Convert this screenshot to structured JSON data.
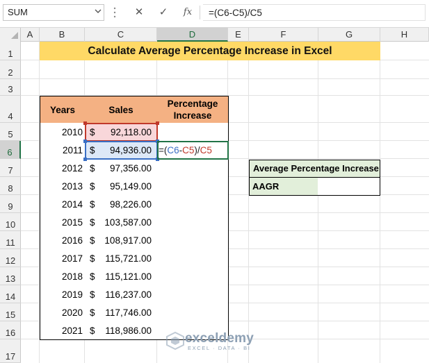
{
  "formula_bar": {
    "name_box": "SUM",
    "cancel_glyph": "✕",
    "enter_glyph": "✓",
    "fx_label": "fx",
    "formula": "=(C6-C5)/C5"
  },
  "columns": [
    "A",
    "B",
    "C",
    "D",
    "E",
    "F",
    "G",
    "H"
  ],
  "rows": [
    "1",
    "2",
    "3",
    "4",
    "5",
    "6",
    "7",
    "8",
    "9",
    "10",
    "11",
    "12",
    "13",
    "14",
    "15",
    "16",
    "17"
  ],
  "selected_column": "D",
  "selected_row": "6",
  "title": "Calculate Average Percentage Increase in Excel",
  "table": {
    "headers": [
      "Years",
      "Sales",
      "Percentage\nIncrease"
    ],
    "currency": "$",
    "rows": [
      {
        "year": "2010",
        "sales": "92,118.00"
      },
      {
        "year": "2011",
        "sales": "94,936.00"
      },
      {
        "year": "2012",
        "sales": "97,356.00"
      },
      {
        "year": "2013",
        "sales": "95,149.00"
      },
      {
        "year": "2014",
        "sales": "98,226.00"
      },
      {
        "year": "2015",
        "sales": "103,587.00"
      },
      {
        "year": "2016",
        "sales": "108,917.00"
      },
      {
        "year": "2017",
        "sales": "115,721.00"
      },
      {
        "year": "2018",
        "sales": "115,121.00"
      },
      {
        "year": "2019",
        "sales": "116,237.00"
      },
      {
        "year": "2020",
        "sales": "117,746.00"
      },
      {
        "year": "2021",
        "sales": "118,986.00"
      }
    ]
  },
  "editing_cell": {
    "parts": [
      {
        "text": "=(",
        "color": "#222222"
      },
      {
        "text": "C6",
        "color": "#3a6fc4"
      },
      {
        "text": "-",
        "color": "#222222"
      },
      {
        "text": "C5",
        "color": "#c0392b"
      },
      {
        "text": ")/",
        "color": "#222222"
      },
      {
        "text": "C5",
        "color": "#c0392b"
      }
    ]
  },
  "side_table": {
    "title": "Average Percentage Increase",
    "label": "AAGR",
    "value": ""
  },
  "watermark": {
    "name": "exceldemy",
    "tagline": "EXCEL · DATA · BI"
  },
  "colors": {
    "title_fill": "#ffd966",
    "header_fill": "#f4b183",
    "side_fill": "#e2efda",
    "ref_blue": "#3a6fc4",
    "ref_red": "#c0392b",
    "select_green": "#217346"
  }
}
